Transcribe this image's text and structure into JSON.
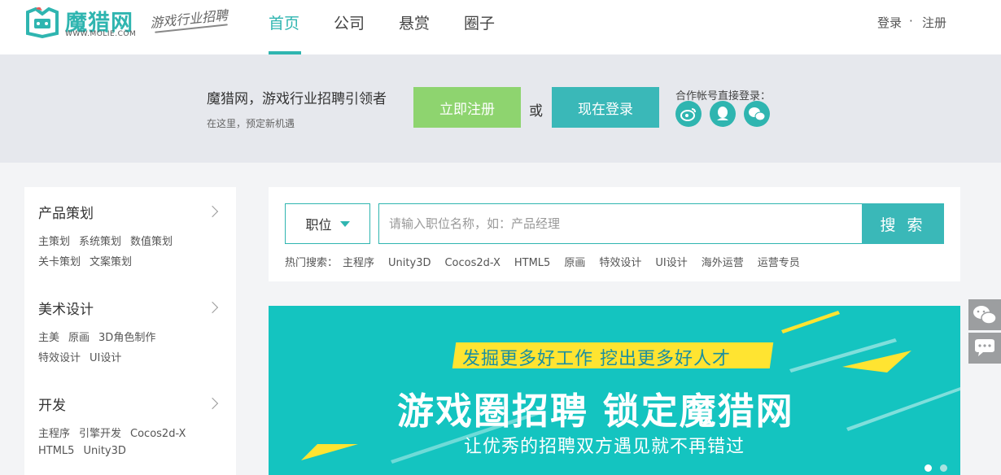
{
  "header": {
    "logo_text": "魔猎网",
    "logo_url": "WWW.MOLIE.COM",
    "slogan": "游戏行业招聘",
    "nav": [
      {
        "label": "首页",
        "active": true
      },
      {
        "label": "公司",
        "active": false
      },
      {
        "label": "悬赏",
        "active": false
      },
      {
        "label": "圈子",
        "active": false
      }
    ],
    "login": "登录",
    "separator": "·",
    "register": "注册"
  },
  "strip": {
    "title": "魔猎网，游戏行业招聘引领者",
    "subtitle": "在这里，预定新机遇",
    "register_button": "立即注册",
    "or": "或",
    "login_button": "现在登录",
    "partner_label": "合作帐号直接登录："
  },
  "sidebar": {
    "categories": [
      {
        "title": "产品策划",
        "row1": [
          "主策划",
          "系统策划",
          "数值策划"
        ],
        "row2": [
          "关卡策划",
          "文案策划"
        ]
      },
      {
        "title": "美术设计",
        "row1": [
          "主美",
          "原画",
          "3D角色制作"
        ],
        "row2": [
          "特效设计",
          "UI设计"
        ]
      },
      {
        "title": "开发",
        "row1": [
          "主程序",
          "引擎开发",
          "Cocos2d-X"
        ],
        "row2": [
          "HTML5",
          "Unity3D"
        ]
      }
    ]
  },
  "search": {
    "select_value": "职位",
    "placeholder": "请输入职位名称，如：产品经理",
    "button": "搜 索",
    "hot_label": "热门搜索：",
    "hot_terms": [
      "主程序",
      "Unity3D",
      "Cocos2d-X",
      "HTML5",
      "原画",
      "特效设计",
      "UI设计",
      "海外运营",
      "运营专员"
    ]
  },
  "banner": {
    "slogan": "发掘更多好工作   挖出更多好人才",
    "headline": "游戏圈招聘   锁定魔猎网",
    "tagline": "让优秀的招聘双方遇见就不再错过"
  },
  "colors": {
    "brand": "#2fb5b0",
    "register_green": "#8ed46f",
    "banner_bg": "#14c4c0",
    "banner_yellow": "#ffe431"
  }
}
